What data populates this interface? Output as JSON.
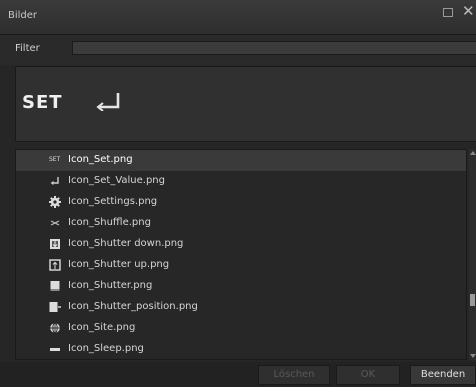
{
  "window": {
    "title": "Bilder",
    "maximize_icon": "maximize-icon",
    "close_glyph": "✕"
  },
  "filter": {
    "label": "Filter",
    "value": "",
    "placeholder": ""
  },
  "preview": {
    "text": "SET",
    "icon": "return-arrow-icon"
  },
  "list": {
    "items": [
      {
        "name": "Icon_Set.png",
        "icon": "set-text-icon",
        "selected": true
      },
      {
        "name": "Icon_Set_Value.png",
        "icon": "return-arrow-icon",
        "selected": false
      },
      {
        "name": "Icon_Settings.png",
        "icon": "gear-icon",
        "selected": false
      },
      {
        "name": "Icon_Shuffle.png",
        "icon": "shuffle-icon",
        "selected": false
      },
      {
        "name": "Icon_Shutter down.png",
        "icon": "shutter-down-icon",
        "selected": false
      },
      {
        "name": "Icon_Shutter up.png",
        "icon": "shutter-up-icon",
        "selected": false
      },
      {
        "name": "Icon_Shutter.png",
        "icon": "shutter-icon",
        "selected": false
      },
      {
        "name": "Icon_Shutter_position.png",
        "icon": "shutter-position-icon",
        "selected": false
      },
      {
        "name": "Icon_Site.png",
        "icon": "globe-icon",
        "selected": false
      },
      {
        "name": "Icon_Sleep.png",
        "icon": "sleep-icon",
        "selected": false
      }
    ],
    "set_icon_text": "SET"
  },
  "buttons": {
    "delete": "Löschen",
    "ok": "OK",
    "exit": "Beenden"
  }
}
